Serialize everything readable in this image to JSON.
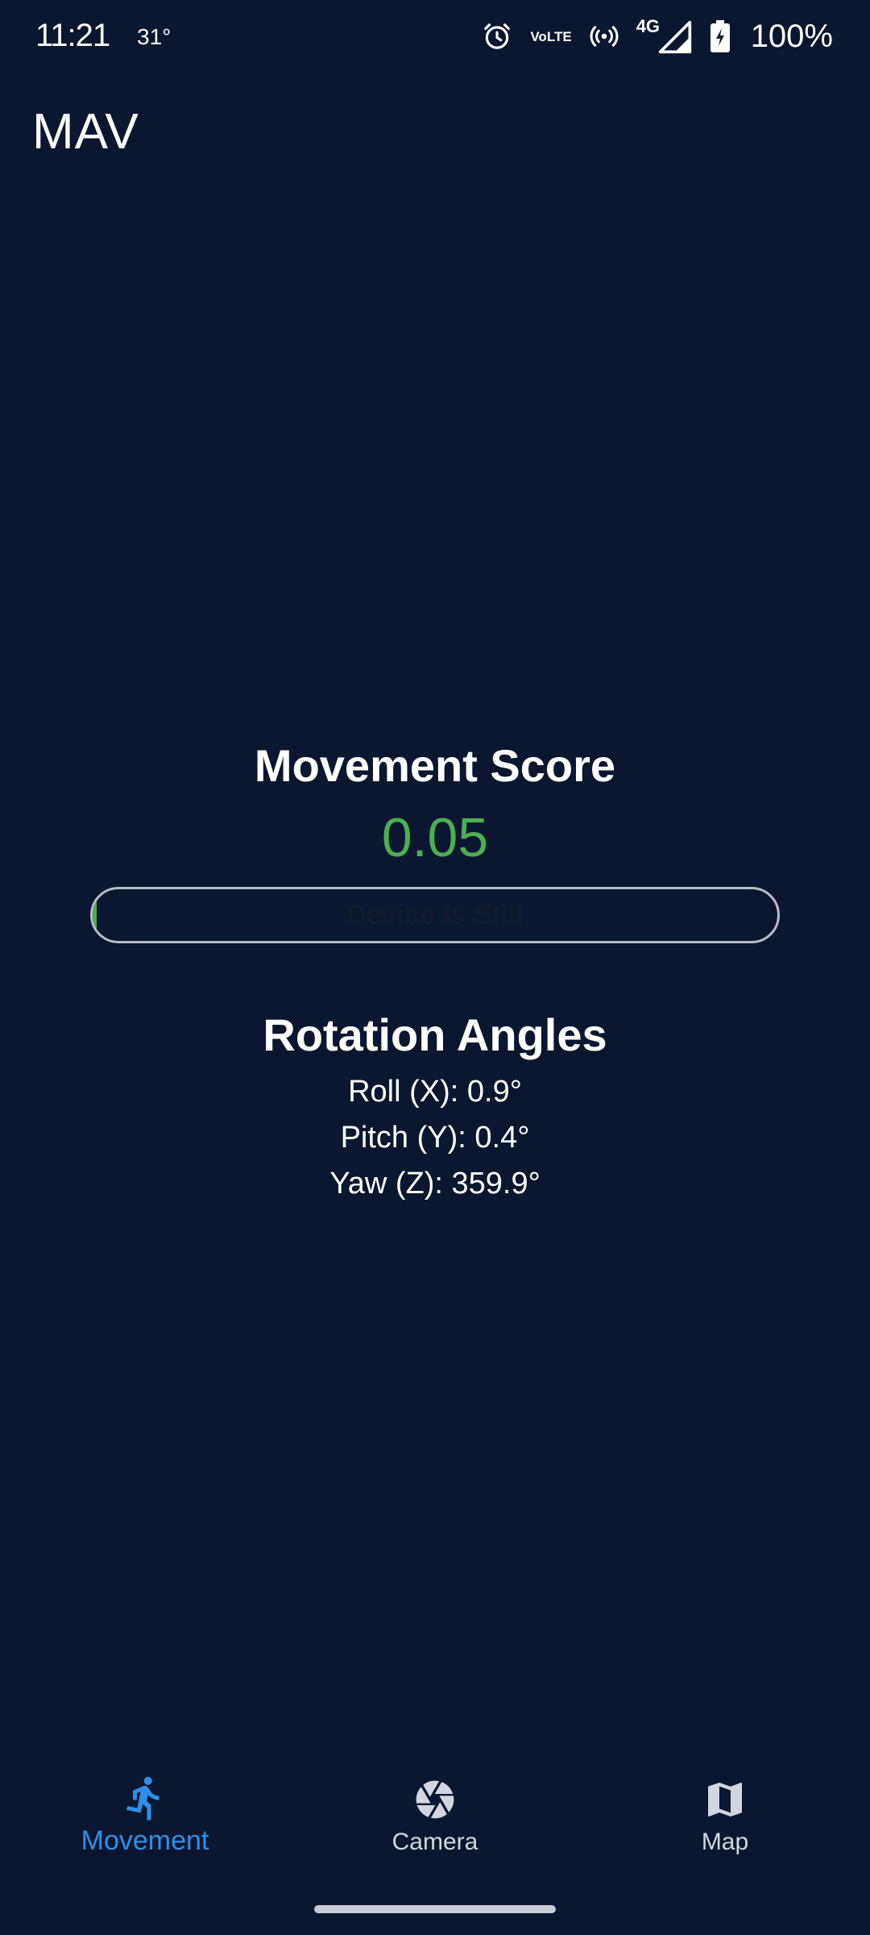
{
  "status_bar": {
    "time": "11:21",
    "temperature": "31°",
    "battery_percent": "100%",
    "network_label": "4G",
    "volte_label_top": "Vo",
    "volte_label_bottom": "LTE"
  },
  "app": {
    "title": "MAV"
  },
  "movement": {
    "score_title": "Movement Score",
    "score_value": "0.05",
    "progress_fraction": 0.005,
    "progress_label": "Device Is Still",
    "score_color": "#4caf50"
  },
  "rotation": {
    "title": "Rotation Angles",
    "roll": "Roll (X): 0.9°",
    "pitch": "Pitch (Y): 0.4°",
    "yaw": "Yaw (Z): 359.9°"
  },
  "bottom_nav": {
    "items": [
      {
        "label": "Movement",
        "icon": "running-person-icon",
        "active": true
      },
      {
        "label": "Camera",
        "icon": "camera-aperture-icon",
        "active": false
      },
      {
        "label": "Map",
        "icon": "map-icon",
        "active": false
      }
    ],
    "active_color": "#2f8fe8"
  }
}
